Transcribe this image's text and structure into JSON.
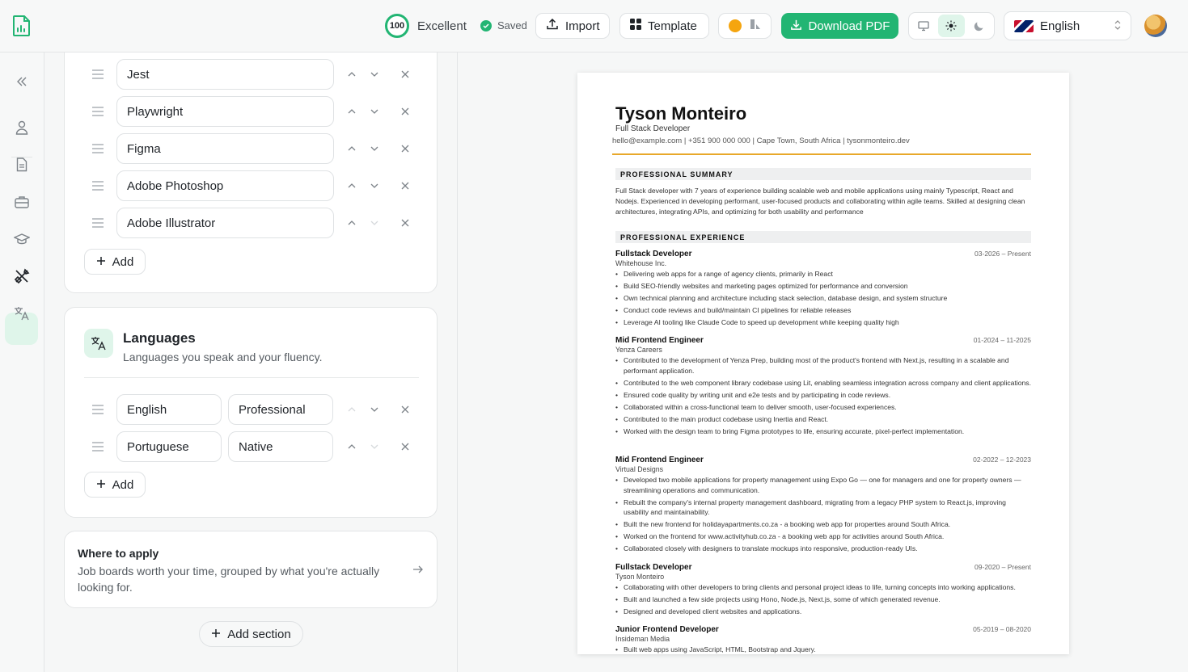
{
  "topbar": {
    "score": "100",
    "score_label": "Excellent",
    "saved": "Saved",
    "import": "Import",
    "template": "Template",
    "download": "Download PDF",
    "language": "English"
  },
  "skills": [
    "Jest",
    "Playwright",
    "Figma",
    "Adobe Photoshop",
    "Adobe Illustrator"
  ],
  "skills_add": "Add",
  "languages": {
    "title": "Languages",
    "subtitle": "Languages you speak and your fluency.",
    "items": [
      {
        "language": "English",
        "level": "Professional"
      },
      {
        "language": "Portuguese",
        "level": "Native"
      }
    ],
    "add": "Add"
  },
  "apply": {
    "title": "Where to apply",
    "text": "Job boards worth your time, grouped by what you're actually looking for."
  },
  "add_section": "Add section",
  "resume": {
    "name": "Tyson Monteiro",
    "role": "Full Stack Developer",
    "contact": "hello@example.com  |  +351 900 000 000  |  Cape Town, South Africa  |  tysonmonteiro.dev",
    "summary_heading": "PROFESSIONAL SUMMARY",
    "summary": "Full Stack developer with 7 years of experience building scalable web and mobile applications using mainly Typescript, React and Nodejs. Experienced in developing performant, user-focused products and collaborating within agile teams. Skilled at designing clean architectures, integrating APIs, and optimizing for both usability and performance",
    "experience_heading": "PROFESSIONAL EXPERIENCE",
    "jobs": [
      {
        "title": "Fullstack Developer",
        "company": "Whitehouse Inc.",
        "dates": "03-2026 – Present",
        "bullets": [
          "Delivering web apps for a range of agency clients, primarily in React",
          "Build SEO-friendly websites and marketing pages optimized for performance and conversion",
          "Own technical planning and architecture including stack selection, database design, and system structure",
          "Conduct code reviews and build/maintain CI pipelines for reliable releases",
          "Leverage AI tooling like Claude Code to speed up development while keeping quality high"
        ]
      },
      {
        "title": "Mid Frontend Engineer",
        "company": "Yenza Careers",
        "dates": "01-2024 – 11-2025",
        "bullets": [
          "Contributed to the development of Yenza Prep, building most of the product's frontend with Next.js, resulting in a scalable and performant application.",
          "Contributed to the web component library codebase using Lit, enabling seamless integration across company and client applications.",
          "Ensured code quality by writing unit and e2e tests and by participating in code reviews.",
          "Collaborated within a cross-functional team to deliver smooth, user-focused experiences.",
          "Contributed to the main product codebase using Inertia and React.",
          "Worked with the design team to bring Figma prototypes to life, ensuring accurate, pixel-perfect implementation."
        ]
      },
      {
        "title": "Mid Frontend Engineer",
        "company": "Virtual Designs",
        "dates": "02-2022 – 12-2023",
        "bullets": [
          "Developed two mobile applications for property management using Expo Go — one for managers and one for property owners — streamlining operations and communication.",
          "Rebuilt the company's internal property management dashboard, migrating from a legacy PHP system to React.js, improving usability and maintainability.",
          "Built the new frontend for holidayapartments.co.za - a booking web app for properties around South Africa.",
          "Worked on the frontend for www.activityhub.co.za - a booking web app for activities around South Africa.",
          "Collaborated closely with designers to translate mockups into responsive, production-ready UIs."
        ]
      },
      {
        "title": "Fullstack Developer",
        "company": "Tyson Monteiro",
        "dates": "09-2020 – Present",
        "bullets": [
          "Collaborating with other developers to bring clients and personal project ideas to life, turning concepts into working applications.",
          "Built and launched a few side projects using Hono, Node.js, Next.js, some of which generated revenue.",
          "Designed and developed client websites and applications."
        ]
      },
      {
        "title": "Junior Frontend Developer",
        "company": "Insideman Media",
        "dates": "05-2019 – 08-2020",
        "bullets": [
          "Built web apps using  JavaScript, HTML, Bootstrap and Jquery."
        ]
      }
    ]
  },
  "colors": {
    "accent": "#22b573",
    "accent_soft": "#dff5ea",
    "rule": "#e8a82a",
    "swatch": "#f5a50f"
  }
}
